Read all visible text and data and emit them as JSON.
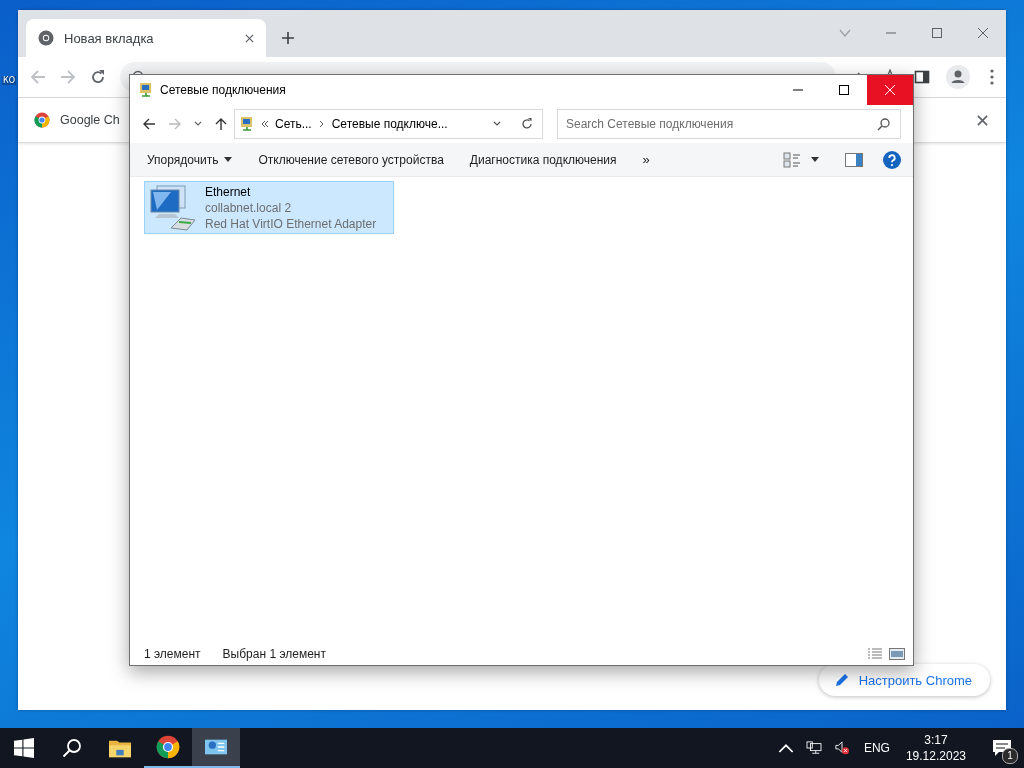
{
  "desktop": {
    "icon_label": "КО"
  },
  "browser": {
    "tabs": [
      {
        "title": "Новая вкладка",
        "selected": true
      }
    ],
    "infobar": {
      "text": "Google Ch"
    },
    "customize_button": "Настроить Chrome"
  },
  "explorer": {
    "title": "Сетевые подключения",
    "close_hovered": true,
    "breadcrumb": [
      "Сеть...",
      "Сетевые подключе..."
    ],
    "search": {
      "placeholder": "Search Сетевые подключения"
    },
    "commands": [
      {
        "label": "Упорядочить",
        "kind": "menu"
      },
      {
        "label": "Отключение сетевого устройства",
        "kind": "action"
      },
      {
        "label": "Диагностика подключения",
        "kind": "action"
      },
      {
        "label": "»",
        "kind": "overflow"
      }
    ],
    "items": [
      {
        "name": "Ethernet",
        "lines": [
          "collabnet.local 2",
          "Red Hat VirtIO Ethernet Adapter"
        ],
        "selected": true
      }
    ],
    "status": {
      "count": "1 элемент",
      "selection": "Выбран 1 элемент"
    }
  },
  "taskbar": {
    "apps": [
      {
        "kind": "folder",
        "running": false,
        "selected": false
      },
      {
        "kind": "chrome",
        "running": true,
        "selected": false
      },
      {
        "kind": "network",
        "running": true,
        "selected": true
      }
    ],
    "language": "ENG",
    "time": "3:17",
    "date": "19.12.2023",
    "notifications": "1"
  }
}
